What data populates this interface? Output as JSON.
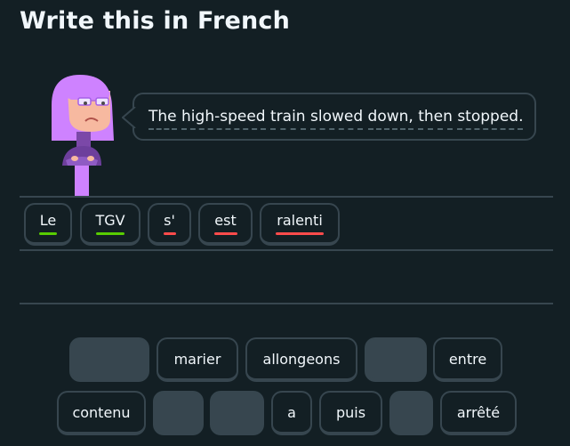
{
  "header": {
    "title": "Write this in French"
  },
  "prompt": {
    "words": [
      "The",
      "high-speed",
      "train",
      "slowed",
      "down,",
      "then",
      "stopped."
    ]
  },
  "answer_tiles": [
    {
      "label": "Le",
      "status": "correct"
    },
    {
      "label": "TGV",
      "status": "correct"
    },
    {
      "label": "s'",
      "status": "incorrect"
    },
    {
      "label": "est",
      "status": "incorrect"
    },
    {
      "label": "ralenti",
      "status": "incorrect"
    }
  ],
  "word_bank": {
    "row1": [
      "",
      "marier",
      "allongeons",
      "",
      "entre"
    ],
    "row2": [
      "contenu",
      "",
      "",
      "a",
      "puis",
      "",
      "arrêté"
    ]
  },
  "colors": {
    "background": "#131f24",
    "border": "#37464f",
    "correct": "#58cc02",
    "incorrect": "#ff4b4b",
    "character_hair": "#ce82ff"
  },
  "icons": {
    "character": "lily-character"
  }
}
